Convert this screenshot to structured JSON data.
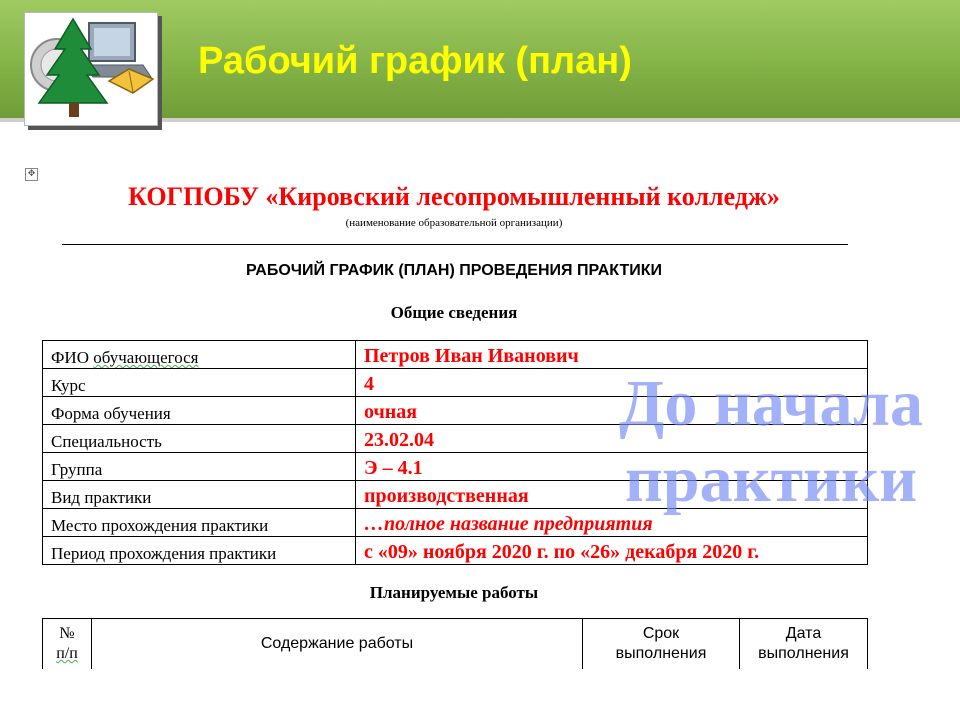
{
  "header": {
    "title": "Рабочий график (план)",
    "accent_color": "#7bab40",
    "title_color": "#ffff00",
    "logo_icon": "forest-computer-book-logo"
  },
  "document": {
    "organization": "КОГПОБУ «Кировский лесопромышленный колледж»",
    "organization_note": "(наименование образовательной организации)",
    "title": "РАБОЧИЙ ГРАФИК (ПЛАН) ПРОВЕДЕНИЯ ПРАКТИКИ",
    "general_heading": "Общие сведения",
    "info_rows": [
      {
        "label_pre": "ФИО ",
        "label_wavy": "обучающегося",
        "value": "Петров Иван Иванович"
      },
      {
        "label_pre": "Курс",
        "label_wavy": "",
        "value": "4"
      },
      {
        "label_pre": "Форма обучения",
        "label_wavy": "",
        "value": "очная"
      },
      {
        "label_pre": "Специальность",
        "label_wavy": "",
        "value": "23.02.04"
      },
      {
        "label_pre": "Группа",
        "label_wavy": "",
        "value": "Э – 4.1"
      },
      {
        "label_pre": "Вид практики",
        "label_wavy": "",
        "value": "производственная"
      },
      {
        "label_pre": "Место прохождения практики",
        "label_wavy": "",
        "value": "…полное название предприятия"
      },
      {
        "label_pre": "Период прохождения практики",
        "label_wavy": "",
        "value": "с «09» ноября 2020 г. по  «26» декабря 2020 г."
      }
    ],
    "planned_heading": "Планируемые работы",
    "plan_headers": {
      "no_line1": "№",
      "no_line2": "п/п",
      "content": "Содержание работы",
      "term_line1": "Срок",
      "term_line2": "выполнения",
      "date_line1": "Дата",
      "date_line2": "выполнения"
    }
  },
  "overlay": {
    "line1": "До начала",
    "line2": "практики",
    "color": "#7f8cf5"
  }
}
